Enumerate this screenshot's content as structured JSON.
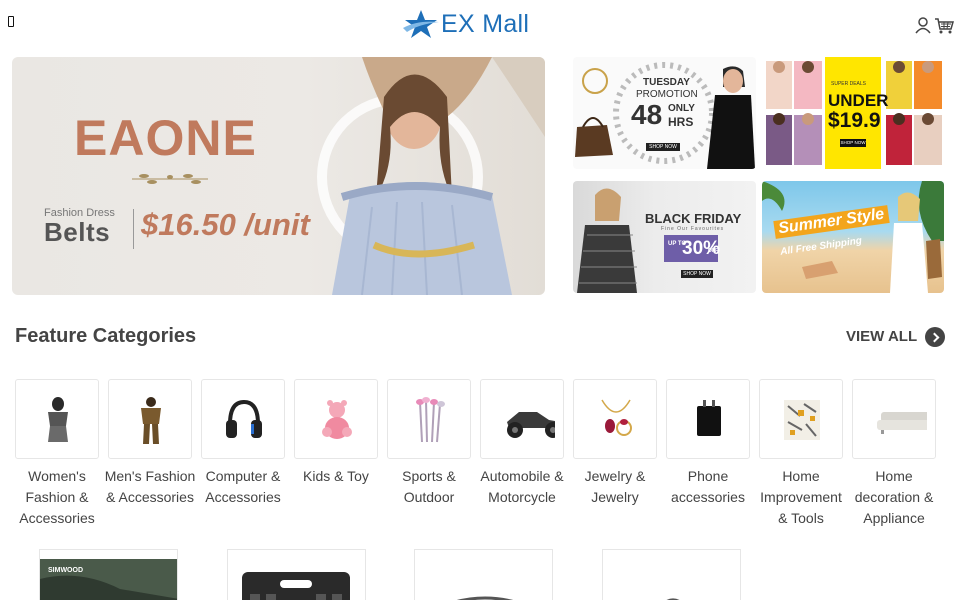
{
  "header": {
    "menu_icon": "menu-icon",
    "logo_text": "EX Mall",
    "brand_color": "#1e6fb8",
    "user_icon": "user-icon",
    "cart_icon": "cart-icon"
  },
  "banners": {
    "main": {
      "brand": "EAONE",
      "subtitle": "Fashion Dress",
      "product": "Belts",
      "price": "$16.50 /unit"
    },
    "tuesday": {
      "title": "TUESDAY",
      "subtitle": "PROMOTION",
      "number": "48",
      "only": "ONLY",
      "hrs": "HRS",
      "cta": "SHOP NOW"
    },
    "under": {
      "top": "SUPER DEALS",
      "text": "UNDER",
      "price": "$19.9",
      "cta": "SHOP NOW"
    },
    "black_friday": {
      "title": "BLACK FRIDAY",
      "small": "Fine Our Favourites",
      "up_to": "UP TO",
      "percent": "30%",
      "off": "OFF",
      "cta": "SHOP NOW"
    },
    "summer": {
      "title": "Summer Style",
      "subtitle": "All Free Shipping"
    }
  },
  "categories_section": {
    "title": "Feature Categories",
    "view_all": "VIEW ALL"
  },
  "categories": [
    {
      "label": "Women's Fashion & Accessories"
    },
    {
      "label": "Men's Fashion & Accessories"
    },
    {
      "label": "Computer & Accessories"
    },
    {
      "label": "Kids & Toy"
    },
    {
      "label": "Sports & Outdoor"
    },
    {
      "label": "Automobile & Motorcycle"
    },
    {
      "label": "Jewelry & Jewelry"
    },
    {
      "label": "Phone accessories"
    },
    {
      "label": "Home Improvement & Tools"
    },
    {
      "label": "Home decoration & Appliance"
    }
  ],
  "products": [
    {
      "brand": "SIMWOOD"
    },
    {
      "brand": ""
    },
    {
      "brand": ""
    },
    {
      "brand": ""
    }
  ]
}
